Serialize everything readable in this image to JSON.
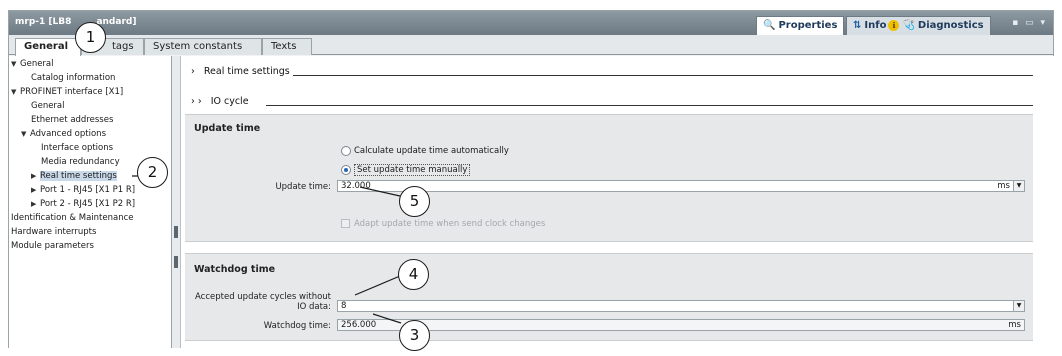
{
  "window": {
    "title": "mrp-1 [LB8",
    "title_suffix": "andard]",
    "right_tabs": [
      {
        "label": "Properties",
        "icon": "properties-icon",
        "glyph": "🔍"
      },
      {
        "label": "Info",
        "icon": "info-icon",
        "glyph": "ℹ"
      },
      {
        "label": "Diagnostics",
        "icon": "diagnostics-icon",
        "glyph": "🩺"
      }
    ],
    "controls": "▪ ▭ ▾"
  },
  "tabs": [
    {
      "label": "General"
    },
    {
      "label": "tags"
    },
    {
      "label": "System constants"
    },
    {
      "label": "Texts"
    }
  ],
  "tree": [
    {
      "label": "General",
      "arrow": "▼"
    },
    {
      "label": "Catalog information",
      "arrow": ""
    },
    {
      "label": "PROFINET interface [X1]",
      "arrow": "▼"
    },
    {
      "label": "General",
      "arrow": ""
    },
    {
      "label": "Ethernet addresses",
      "arrow": ""
    },
    {
      "label": "Advanced options",
      "arrow": "▼"
    },
    {
      "label": "Interface options",
      "arrow": ""
    },
    {
      "label": "Media redundancy",
      "arrow": ""
    },
    {
      "label": "Real time settings",
      "arrow": "▶"
    },
    {
      "label": "Port 1 - RJ45 [X1 P1 R]",
      "arrow": "▶"
    },
    {
      "label": "Port 2 - RJ45 [X1 P2 R]",
      "arrow": "▶"
    },
    {
      "label": "Identification & Maintenance",
      "arrow": ""
    },
    {
      "label": "Hardware interrupts",
      "arrow": ""
    },
    {
      "label": "Module parameters",
      "arrow": ""
    }
  ],
  "content": {
    "real_time_heading": "Real time settings",
    "real_time_arrow": "›",
    "io_cycle_heading": "IO cycle",
    "io_cycle_arrow": "› ›",
    "update_time": {
      "title": "Update time",
      "radio_auto": "Calculate update time automatically",
      "radio_manual": "Set update time manually",
      "selected": "manual",
      "field_label": "Update time:",
      "field_value": "32.000",
      "unit": "ms",
      "checkbox_label": "Adapt update time when send clock changes",
      "checkbox_checked": false
    },
    "watchdog": {
      "title": "Watchdog time",
      "cycles_label_line1": "Accepted update cycles without",
      "cycles_label_line2": "IO data:",
      "cycles_value": "8",
      "time_label": "Watchdog time:",
      "time_value": "256.000",
      "time_unit": "ms"
    }
  },
  "callouts": [
    "1",
    "2",
    "3",
    "4",
    "5"
  ]
}
